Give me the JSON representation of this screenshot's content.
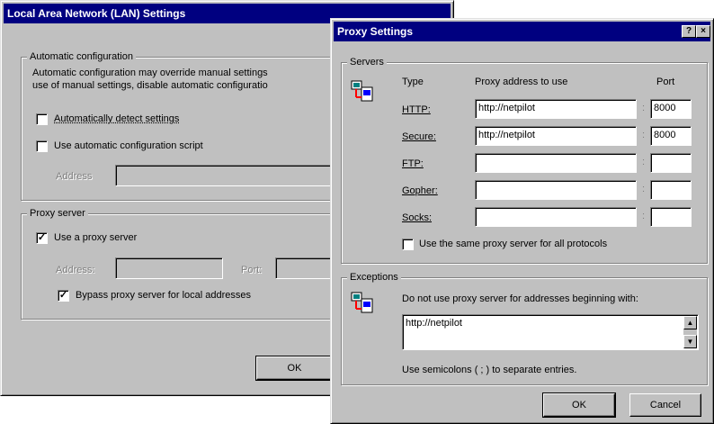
{
  "lan": {
    "title": "Local Area Network (LAN) Settings",
    "auto_config": {
      "group_title": "Automatic configuration",
      "description_line1": "Automatic configuration may override manual settings",
      "description_line2": "use of manual settings, disable automatic configuratio",
      "auto_detect_label": "Automatically detect settings",
      "auto_detect_checked": false,
      "use_script_label": "Use automatic configuration script",
      "use_script_checked": false,
      "address_label": "Address",
      "address_value": ""
    },
    "proxy": {
      "group_title": "Proxy server",
      "use_proxy_label": "Use a proxy server",
      "use_proxy_checked": true,
      "address_label": "Address:",
      "address_value": "",
      "port_label": "Port:",
      "port_value": "",
      "bypass_label": "Bypass proxy server for local addresses",
      "bypass_checked": true
    },
    "ok_label": "OK"
  },
  "proxy_settings": {
    "title": "Proxy Settings",
    "title_buttons": {
      "help": "?",
      "close": "×"
    },
    "servers": {
      "group_title": "Servers",
      "col_type": "Type",
      "col_address": "Proxy address to use",
      "col_port": "Port",
      "rows": [
        {
          "label": "HTTP:",
          "address": "http://netpilot",
          "port": "8000"
        },
        {
          "label": "Secure:",
          "address": "http://netpilot",
          "port": "8000"
        },
        {
          "label": "FTP:",
          "address": "",
          "port": ""
        },
        {
          "label": "Gopher:",
          "address": "",
          "port": ""
        },
        {
          "label": "Socks:",
          "address": "",
          "port": ""
        }
      ],
      "same_proxy_label": "Use the same proxy server for all protocols",
      "same_proxy_checked": false
    },
    "exceptions": {
      "group_title": "Exceptions",
      "description": "Do not use proxy server for addresses beginning with:",
      "value": "http://netpilot",
      "hint": "Use semicolons ( ; ) to separate entries."
    },
    "ok_label": "OK",
    "cancel_label": "Cancel"
  }
}
